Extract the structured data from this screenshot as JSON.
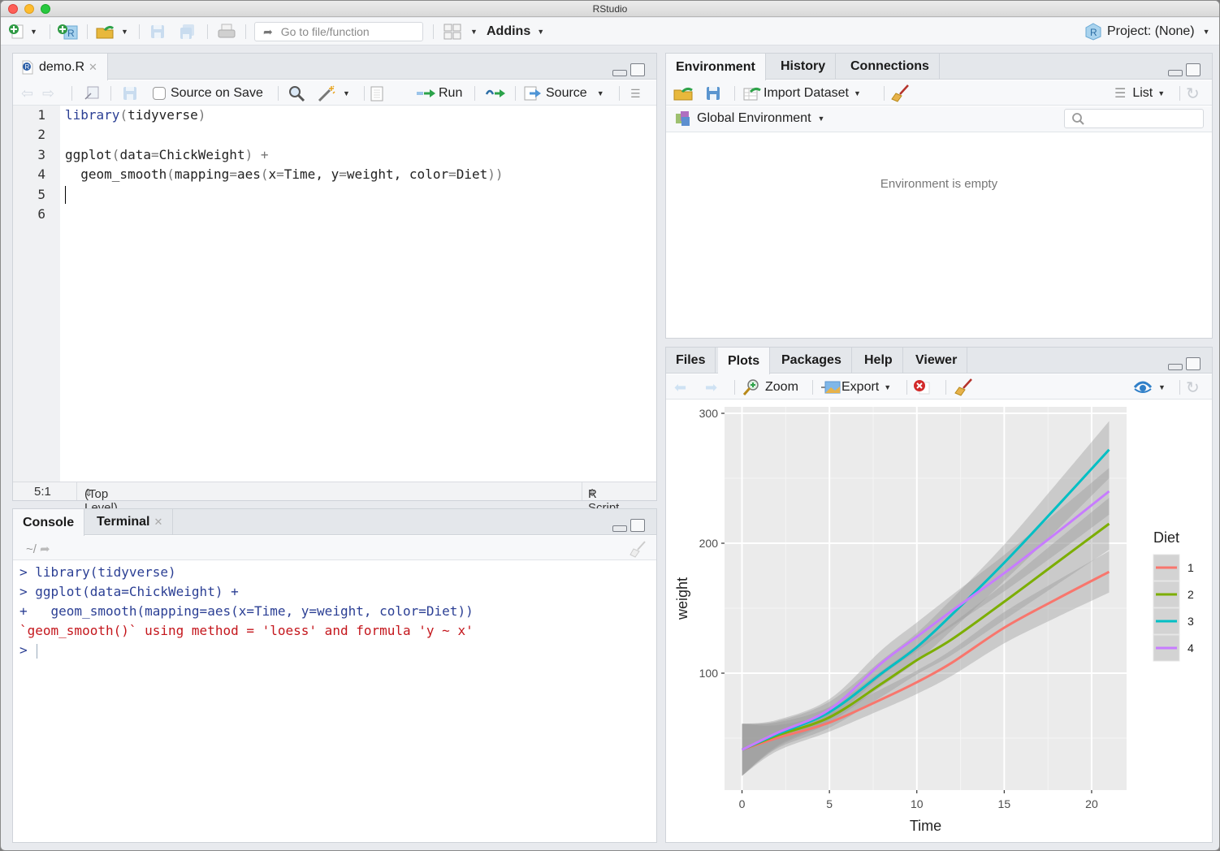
{
  "window": {
    "title": "RStudio"
  },
  "main_toolbar": {
    "goto_placeholder": "Go to file/function",
    "addins_label": "Addins",
    "project_label": "Project: (None)"
  },
  "editor": {
    "tab_label": "demo.R",
    "source_on_save_label": "Source on Save",
    "source_on_save_checked": false,
    "run_label": "Run",
    "source_label": "Source",
    "lines": [
      {
        "num": "1",
        "tokens": [
          {
            "t": "library",
            "c": "kw"
          },
          {
            "t": "(",
            "c": "op"
          },
          {
            "t": "tidyverse",
            "c": ""
          },
          {
            "t": ")",
            "c": "op"
          }
        ]
      },
      {
        "num": "2",
        "tokens": []
      },
      {
        "num": "3",
        "tokens": [
          {
            "t": "ggplot",
            "c": ""
          },
          {
            "t": "(",
            "c": "op"
          },
          {
            "t": "data",
            "c": ""
          },
          {
            "t": "=",
            "c": "op"
          },
          {
            "t": "ChickWeight",
            "c": ""
          },
          {
            "t": ")",
            "c": "op"
          },
          {
            "t": " +",
            "c": "op"
          }
        ]
      },
      {
        "num": "4",
        "tokens": [
          {
            "t": "  geom_smooth",
            "c": ""
          },
          {
            "t": "(",
            "c": "op"
          },
          {
            "t": "mapping",
            "c": ""
          },
          {
            "t": "=",
            "c": "op"
          },
          {
            "t": "aes",
            "c": ""
          },
          {
            "t": "(",
            "c": "op"
          },
          {
            "t": "x",
            "c": ""
          },
          {
            "t": "=",
            "c": "op"
          },
          {
            "t": "Time, y",
            "c": ""
          },
          {
            "t": "=",
            "c": "op"
          },
          {
            "t": "weight, color",
            "c": ""
          },
          {
            "t": "=",
            "c": "op"
          },
          {
            "t": "Diet",
            "c": ""
          },
          {
            "t": "))",
            "c": "op"
          }
        ]
      },
      {
        "num": "5",
        "tokens": []
      },
      {
        "num": "6",
        "tokens": []
      }
    ],
    "status": {
      "position": "5:1",
      "scope": "(Top Level)",
      "file_type": "R Script"
    }
  },
  "console": {
    "tabs": [
      {
        "label": "Console"
      },
      {
        "label": "Terminal"
      }
    ],
    "path": "~/",
    "lines": [
      {
        "text": "> library(tidyverse)",
        "color": "blue"
      },
      {
        "text": "> ggplot(data=ChickWeight) +",
        "color": "blue"
      },
      {
        "text": "+   geom_smooth(mapping=aes(x=Time, y=weight, color=Diet))",
        "color": "blue"
      },
      {
        "text": "`geom_smooth()` using method = 'loess' and formula 'y ~ x'",
        "color": "red"
      },
      {
        "text": "> ",
        "color": "blue"
      }
    ]
  },
  "env_pane": {
    "tabs": [
      {
        "label": "Environment"
      },
      {
        "label": "History"
      },
      {
        "label": "Connections"
      }
    ],
    "import_dataset_label": "Import Dataset",
    "list_label": "List",
    "scope_label": "Global Environment",
    "search_placeholder": "",
    "empty_message": "Environment is empty"
  },
  "plots_pane": {
    "tabs": [
      {
        "label": "Files"
      },
      {
        "label": "Plots"
      },
      {
        "label": "Packages"
      },
      {
        "label": "Help"
      },
      {
        "label": "Viewer"
      }
    ],
    "zoom_label": "Zoom",
    "export_label": "Export"
  },
  "chart_data": {
    "type": "line",
    "title": "",
    "xlabel": "Time",
    "ylabel": "weight",
    "xlim": [
      -1,
      22
    ],
    "ylim": [
      10,
      305
    ],
    "xticks": [
      0,
      5,
      10,
      15,
      20
    ],
    "yticks": [
      100,
      200,
      300
    ],
    "grid": true,
    "legend": {
      "title": "Diet",
      "position": "right"
    },
    "x": [
      0,
      2,
      5,
      8,
      10,
      12,
      15,
      18,
      21
    ],
    "series": [
      {
        "name": "1",
        "color": "#F8766D",
        "values": [
          41,
          50,
          62,
          80,
          93,
          108,
          135,
          157,
          178
        ],
        "ci_halfwidth": [
          20,
          10,
          7,
          8,
          9,
          10,
          12,
          14,
          16
        ]
      },
      {
        "name": "2",
        "color": "#7CAE00",
        "values": [
          41,
          52,
          66,
          92,
          110,
          126,
          155,
          185,
          215
        ],
        "ci_halfwidth": [
          20,
          10,
          8,
          10,
          11,
          12,
          14,
          17,
          20
        ]
      },
      {
        "name": "3",
        "color": "#00BFC4",
        "values": [
          41,
          53,
          70,
          100,
          120,
          145,
          185,
          228,
          272
        ],
        "ci_halfwidth": [
          20,
          10,
          8,
          10,
          11,
          12,
          14,
          18,
          22
        ]
      },
      {
        "name": "4",
        "color": "#C77CFF",
        "values": [
          41,
          54,
          72,
          108,
          128,
          148,
          177,
          208,
          240
        ],
        "ci_halfwidth": [
          20,
          10,
          8,
          10,
          11,
          12,
          14,
          16,
          18
        ]
      }
    ]
  }
}
